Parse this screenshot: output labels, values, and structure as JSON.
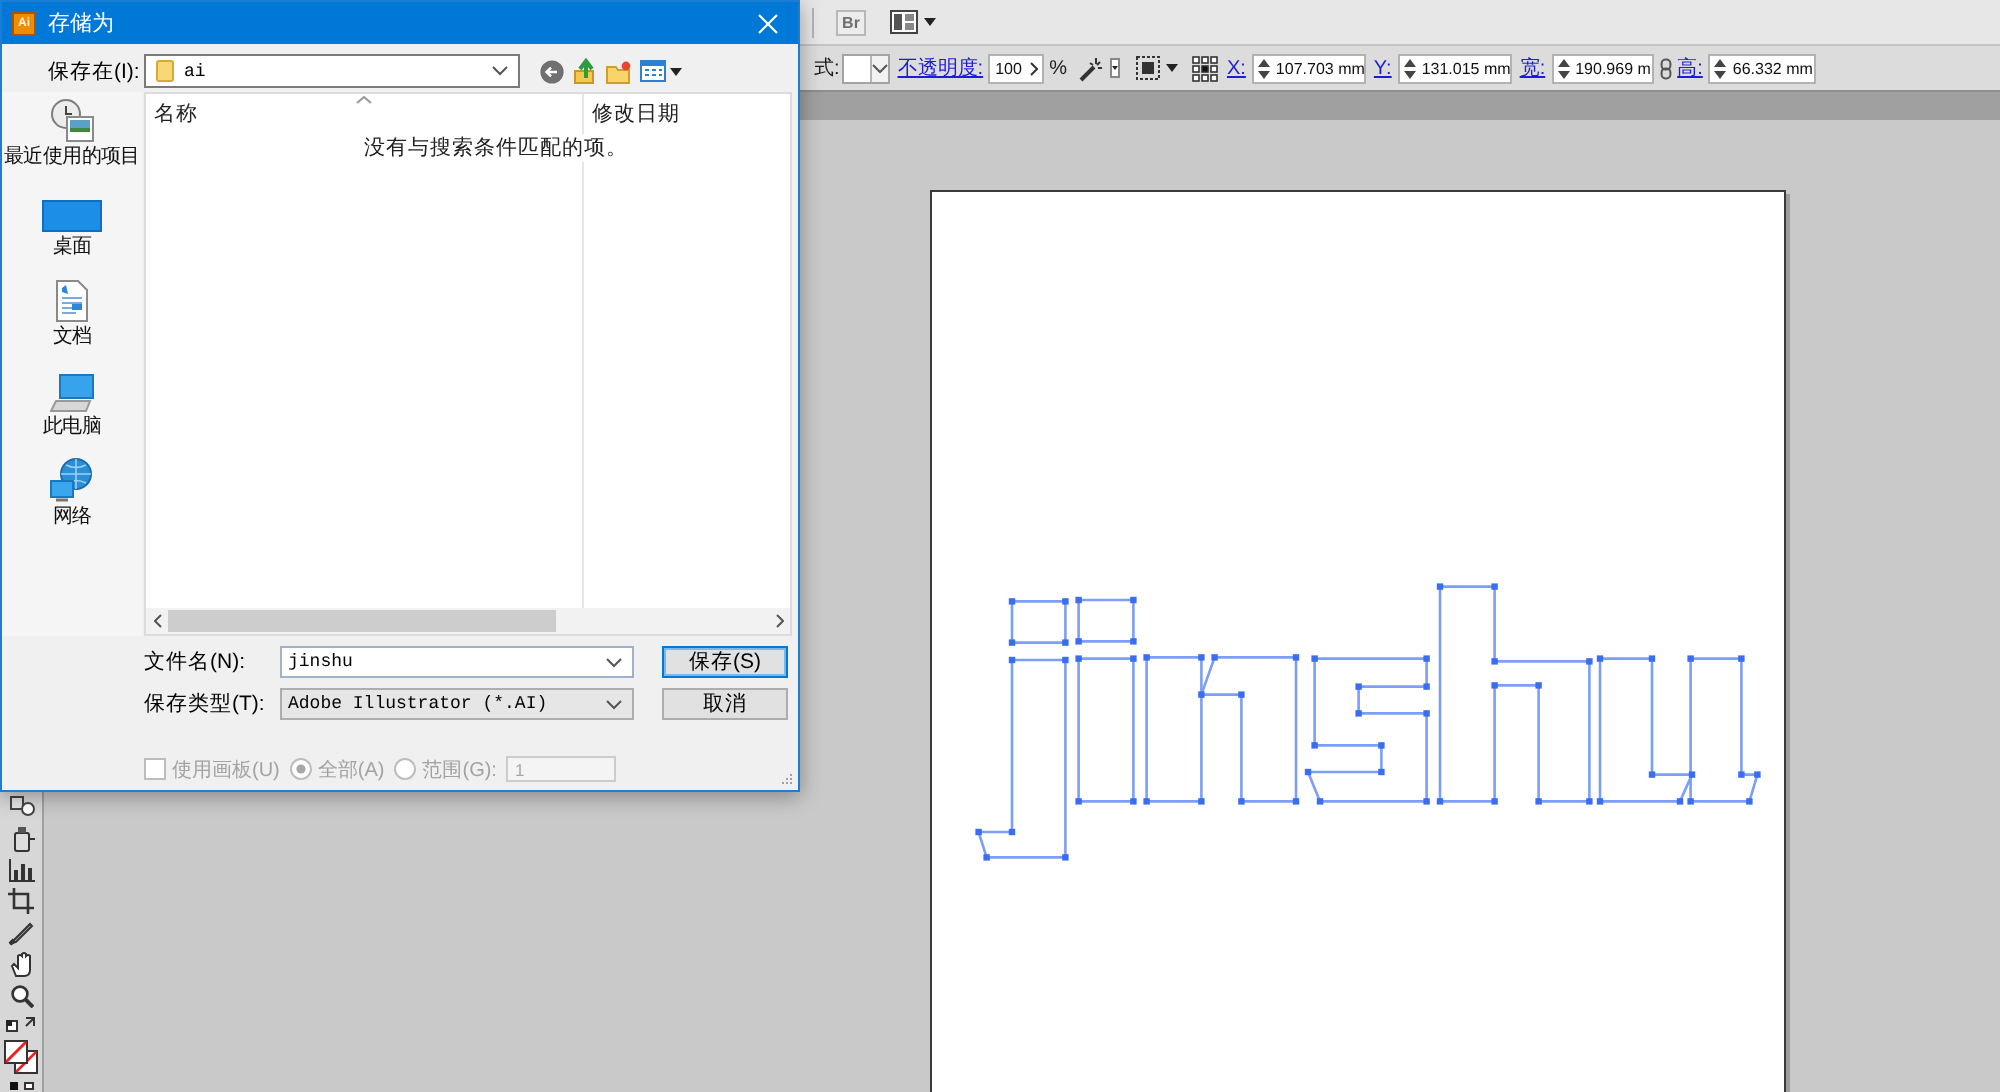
{
  "app": {
    "bridge_button": {
      "label": "Br",
      "disabled": true
    },
    "control_bar": {
      "style_label": "式:",
      "opacity_label": "不透明度:",
      "opacity": "100",
      "opacity_unit": "%",
      "x_label": "X:",
      "x": "107.703 mm",
      "y_label": "Y:",
      "y": "131.015 mm",
      "width_label": "宽:",
      "width": "190.969 m",
      "height_label": "高:",
      "height": "66.332 mm"
    }
  },
  "dialog": {
    "app_badge": "Ai",
    "title": "存储为",
    "save_in_label": "保存在(I):",
    "folder": "ai",
    "places": [
      {
        "kind": "recent",
        "label": "最近使用的项目"
      },
      {
        "kind": "desktop",
        "label": "桌面"
      },
      {
        "kind": "documents",
        "label": "文档"
      },
      {
        "kind": "computer",
        "label": "此电脑"
      },
      {
        "kind": "network",
        "label": "网络"
      }
    ],
    "columns": [
      {
        "label": "名称",
        "sorted": true
      },
      {
        "label": "修改日期",
        "sorted": false
      }
    ],
    "empty_message": "没有与搜索条件匹配的项。",
    "file_name_label": "文件名(N):",
    "file_name": "jinshu",
    "file_type_label": "保存类型(T):",
    "file_type": "Adobe Illustrator (*.AI)",
    "buttons": [
      {
        "label": "保存(S)",
        "default": true
      },
      {
        "label": "取消",
        "default": false
      }
    ],
    "use_artboards": {
      "label": "使用画板(U)",
      "checked": false,
      "disabled": true
    },
    "range_options": [
      {
        "label": "全部(A)",
        "selected": true,
        "disabled": true
      },
      {
        "label": "范围(G):",
        "selected": false,
        "disabled": true
      }
    ],
    "range_field": {
      "value": "1",
      "disabled": true
    }
  }
}
